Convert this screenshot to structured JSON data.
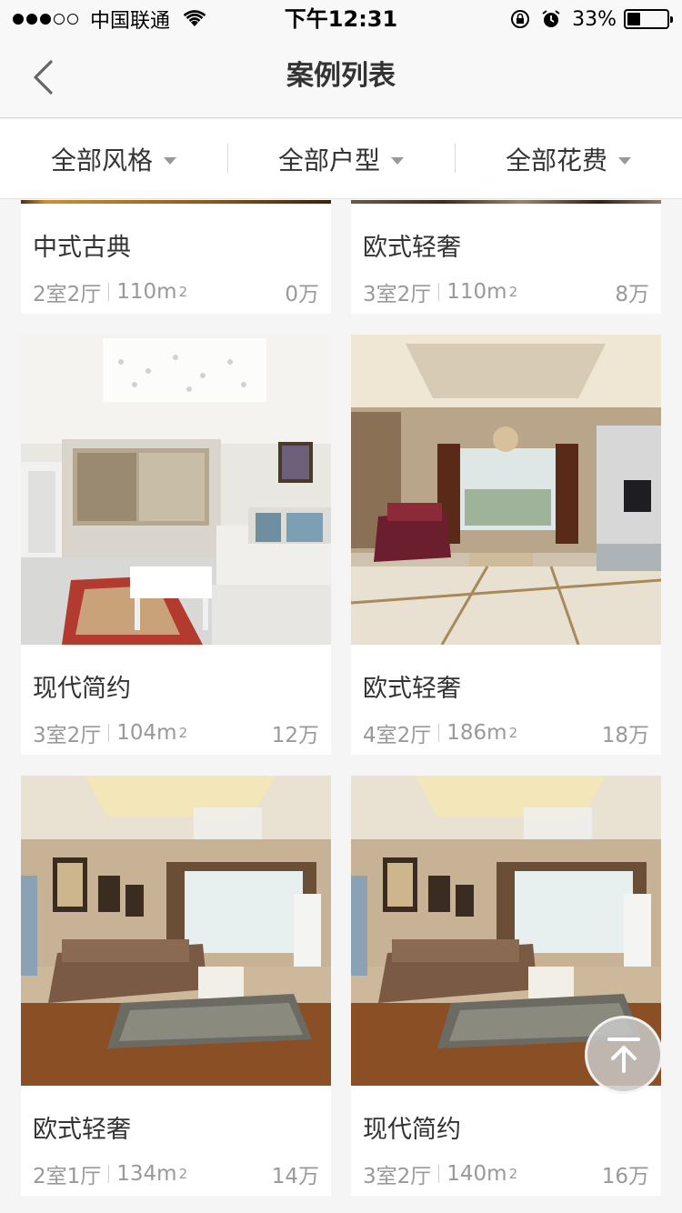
{
  "status_bar": {
    "carrier": "中国联通",
    "time": "下午12:31",
    "battery": "33%",
    "battery_level": 0.33
  },
  "nav": {
    "title": "案例列表",
    "back_icon": "chevron-left-icon"
  },
  "filters": [
    {
      "label": "全部风格"
    },
    {
      "label": "全部户型"
    },
    {
      "label": "全部花费"
    }
  ],
  "cases": [
    {
      "title": "中式古典",
      "layout": "2室2厅",
      "area": "110m",
      "area_unit_sup": "2",
      "cost": "0万"
    },
    {
      "title": "欧式轻奢",
      "layout": "3室2厅",
      "area": "110m",
      "area_unit_sup": "2",
      "cost": "8万"
    },
    {
      "title": "现代简约",
      "layout": "3室2厅",
      "area": "104m",
      "area_unit_sup": "2",
      "cost": "12万"
    },
    {
      "title": "欧式轻奢",
      "layout": "4室2厅",
      "area": "186m",
      "area_unit_sup": "2",
      "cost": "18万"
    },
    {
      "title": "欧式轻奢",
      "layout": "2室1厅",
      "area": "134m",
      "area_unit_sup": "2",
      "cost": "14万"
    },
    {
      "title": "现代简约",
      "layout": "3室2厅",
      "area": "140m",
      "area_unit_sup": "2",
      "cost": "16万"
    }
  ],
  "back_to_top_icon": "arrow-up-to-top-icon",
  "colors": {
    "text_primary": "#333333",
    "text_secondary": "#999999",
    "background": "#f5f5f5"
  }
}
